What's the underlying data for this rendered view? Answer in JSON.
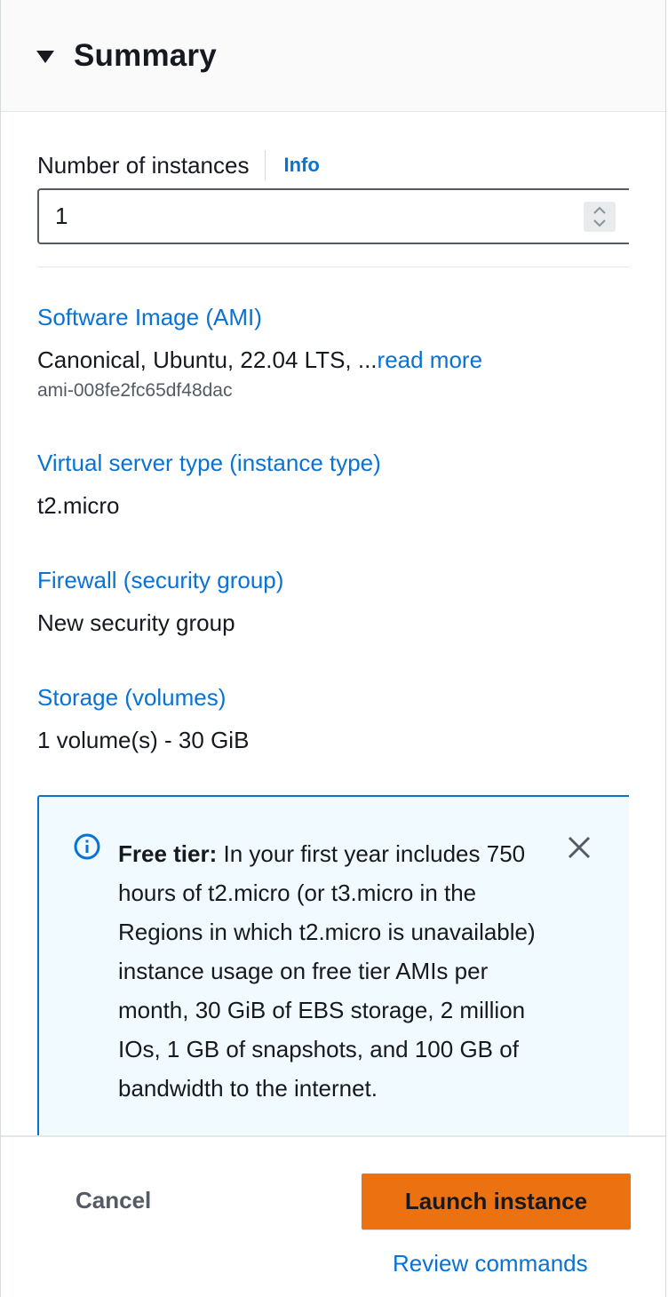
{
  "summary": {
    "title": "Summary",
    "instances": {
      "label": "Number of instances",
      "info_link": "Info",
      "value": "1"
    },
    "sections": [
      {
        "title": "Software Image (AMI)",
        "value": "Canonical, Ubuntu, 22.04 LTS, ...",
        "value_link": "read more",
        "sub": "ami-008fe2fc65df48dac"
      },
      {
        "title": "Virtual server type (instance type)",
        "value": "t2.micro"
      },
      {
        "title": "Firewall (security group)",
        "value": "New security group"
      },
      {
        "title": "Storage (volumes)",
        "value": "1 volume(s) - 30 GiB"
      }
    ],
    "alert": {
      "heading": "Free tier:",
      "body": "In your first year includes 750 hours of t2.micro (or t3.micro in the Regions in which t2.micro is unavailable) instance usage on free tier AMIs per month, 30 GiB of EBS storage, 2 million IOs, 1 GB of snapshots, and 100 GB of bandwidth to the internet."
    }
  },
  "footer": {
    "cancel_label": "Cancel",
    "launch_label": "Launch instance",
    "review_label": "Review commands"
  },
  "colors": {
    "link": "#0972d3",
    "primary_button": "#ec7211",
    "alert_border": "#0972d3",
    "alert_bg": "#f1faff"
  },
  "icons": {
    "collapse": "caret-down-icon",
    "spinner": "up-down-chevron-icon",
    "info": "info-circle-icon",
    "close": "close-icon"
  }
}
